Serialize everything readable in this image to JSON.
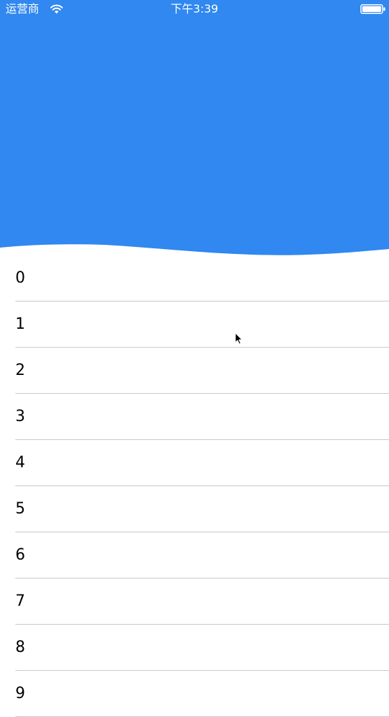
{
  "status_bar": {
    "carrier": "运营商",
    "time": "下午3:39",
    "wifi_icon": "wifi-icon",
    "battery_icon": "battery-icon"
  },
  "header": {
    "color": "#3088f0"
  },
  "list": {
    "rows": [
      "0",
      "1",
      "2",
      "3",
      "4",
      "5",
      "6",
      "7",
      "8",
      "9"
    ]
  }
}
